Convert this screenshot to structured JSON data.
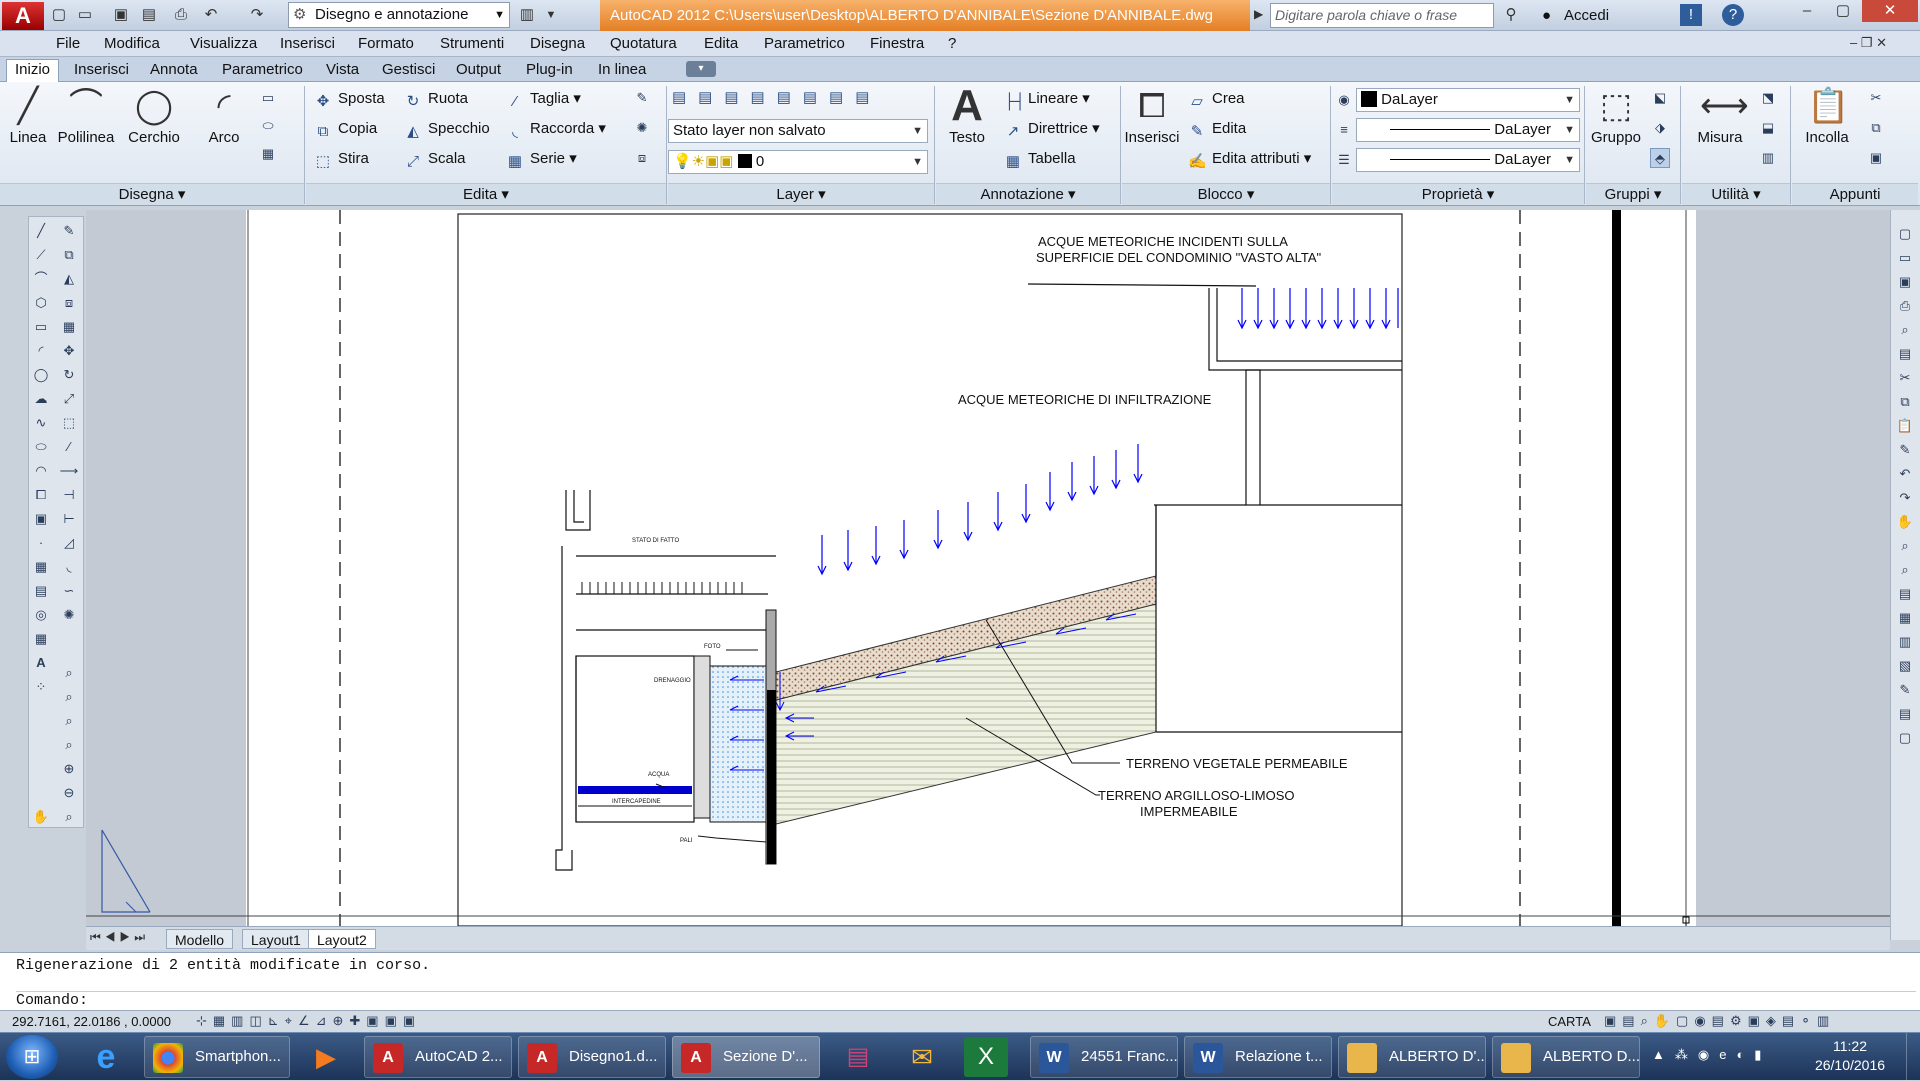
{
  "titlebar": {
    "app_logo": "A",
    "workspace": "Disegno e annotazione",
    "title": "AutoCAD 2012    C:\\Users\\user\\Desktop\\ALBERTO D'ANNIBALE\\Sezione D'ANNIBALE.dwg",
    "search_placeholder": "Digitare parola chiave o frase",
    "signin": "Accedi"
  },
  "menu": [
    "File",
    "Modifica",
    "Visualizza",
    "Inserisci",
    "Formato",
    "Strumenti",
    "Disegna",
    "Quotatura",
    "Edita",
    "Parametrico",
    "Finestra",
    "?"
  ],
  "ribbon_tabs": [
    "Inizio",
    "Inserisci",
    "Annota",
    "Parametrico",
    "Vista",
    "Gestisci",
    "Output",
    "Plug-in",
    "In linea"
  ],
  "ribbon": {
    "disegna": {
      "title": "Disegna",
      "buttons": [
        "Linea",
        "Polilinea",
        "Cerchio",
        "Arco"
      ]
    },
    "edita": {
      "title": "Edita",
      "buttons": [
        "Sposta",
        "Ruota",
        "Taglia",
        "Copia",
        "Specchio",
        "Raccorda",
        "Stira",
        "Scala",
        "Serie"
      ]
    },
    "layer": {
      "title": "Layer",
      "state": "Stato layer non salvato",
      "current": "0"
    },
    "annotazione": {
      "title": "Annotazione",
      "text_btn": "Testo",
      "buttons": [
        "Lineare",
        "Direttrice",
        "Tabella"
      ]
    },
    "blocco": {
      "title": "Blocco",
      "insert": "Inserisci",
      "buttons": [
        "Crea",
        "Edita",
        "Edita attributi"
      ]
    },
    "proprieta": {
      "title": "Proprietà",
      "color": "DaLayer",
      "linetype": "DaLayer",
      "lineweight": "DaLayer"
    },
    "gruppi": {
      "title": "Gruppi",
      "btn": "Gruppo"
    },
    "utilita": {
      "title": "Utilità",
      "btn": "Misura"
    },
    "appunti": {
      "title": "Appunti",
      "btn": "Incolla"
    }
  },
  "drawing": {
    "label_top": "ACQUE METEORICHE INCIDENTI SULLA",
    "label_top2": "SUPERFICIE DEL CONDOMINIO \"VASTO ALTA\"",
    "label_infiltrazione": "ACQUE METEORICHE DI INFILTRAZIONE",
    "label_stato": "STATO DI FATTO",
    "label_foto": "FOTO",
    "label_drenaggio": "DRENAGGIO",
    "label_acqua": "ACQUA",
    "label_intercapedine": "INTERCAPEDINE",
    "label_pali": "PALI",
    "label_vegetale": "TERRENO VEGETALE PERMEABILE",
    "label_argilloso": "TERRENO ARGILLOSO-LIMOSO",
    "label_impermeabile": "IMPERMEABILE"
  },
  "layout_tabs": [
    "Modello",
    "Layout1",
    "Layout2"
  ],
  "command": {
    "history": "Rigenerazione di 2 entità modificate in corso.",
    "prompt": "Comando:"
  },
  "status": {
    "coords": "292.7161, 22.0186 , 0.0000",
    "mode": "CARTA"
  },
  "taskbar": {
    "items": [
      "Smartphon...",
      "AutoCAD 2...",
      "Disegno1.d...",
      "Sezione D'...",
      "24551 Franc...",
      "Relazione t...",
      "ALBERTO D'...",
      "ALBERTO D..."
    ],
    "time": "11:22",
    "date": "26/10/2016"
  },
  "colors": {
    "accent": "#e47f24",
    "hatch_blue": "#0000ff",
    "taskbar": "#1d3358"
  }
}
